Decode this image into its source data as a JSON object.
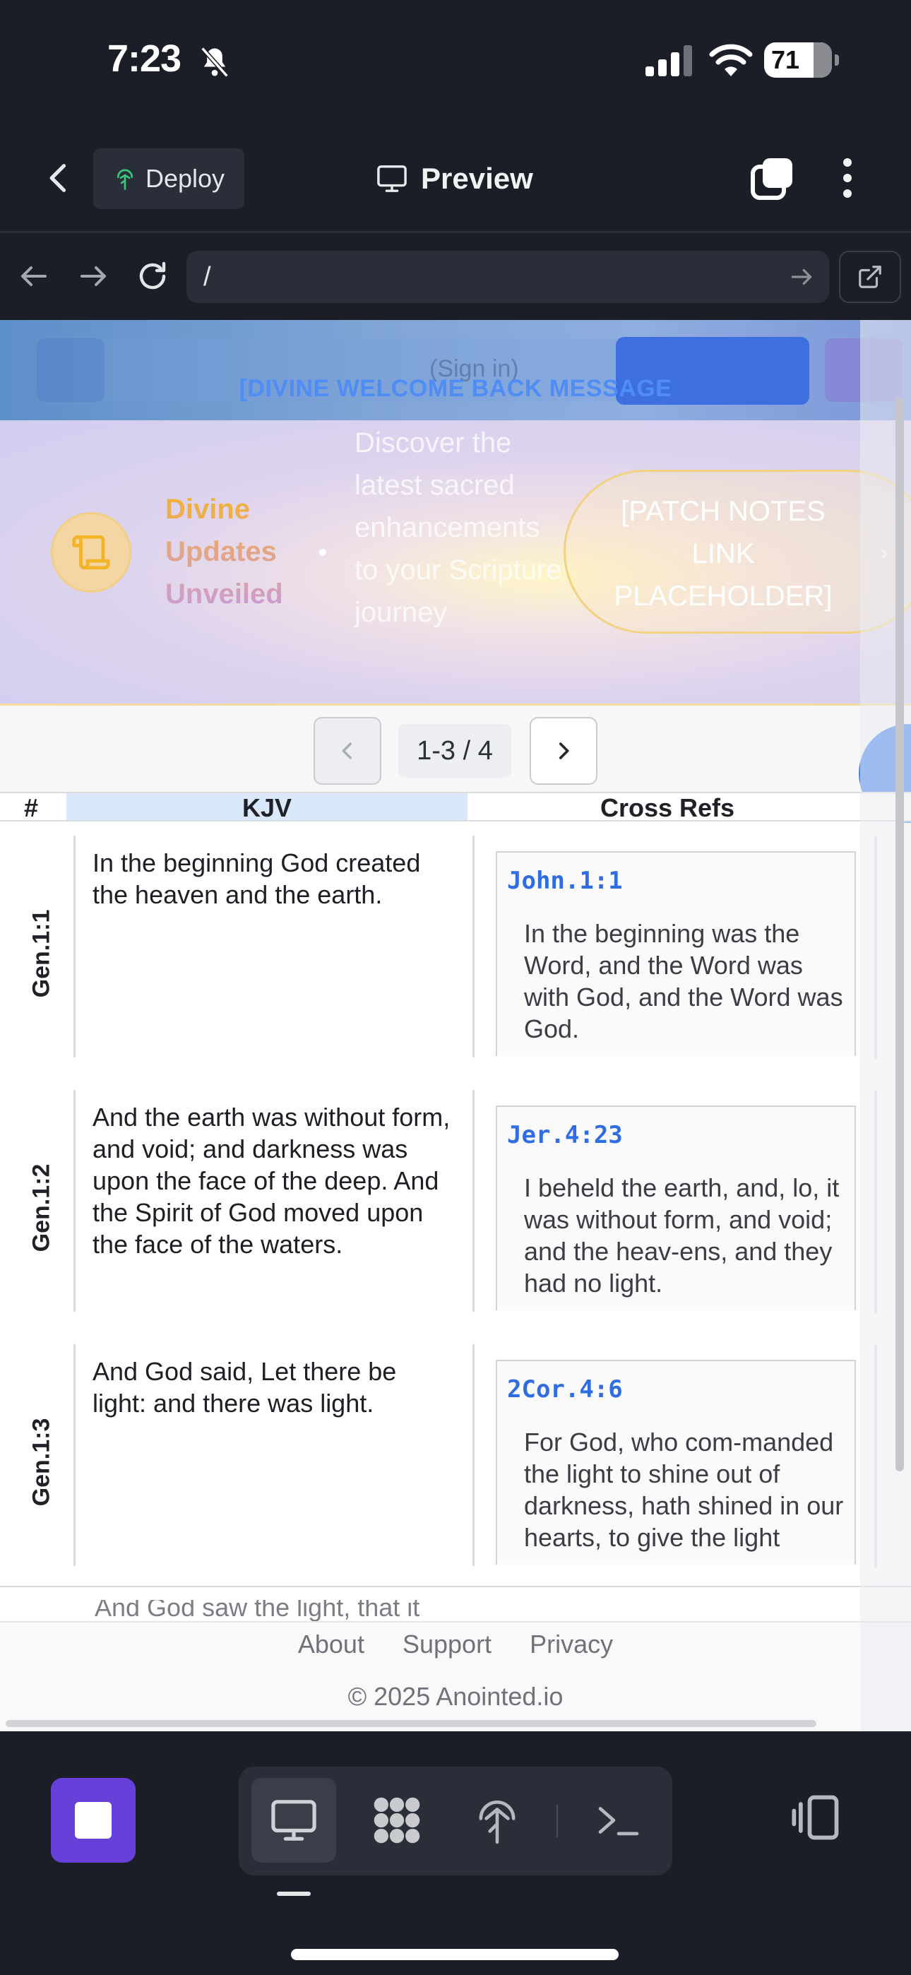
{
  "status_bar": {
    "time": "7:23",
    "battery": "71"
  },
  "app_header": {
    "deploy_label": "Deploy",
    "preview_label": "Preview"
  },
  "browser": {
    "url": "/"
  },
  "site": {
    "nav": {
      "sign_in_label": "(Sign in)",
      "welcome": "[DIVINE WELCOME BACK MESSAGE"
    },
    "banner": {
      "title": "Divine Updates Unveiled",
      "description": "Discover the latest sacred enhancements to your Scripture journey",
      "patch_link": "[PATCH NOTES LINK PLACEHOLDER]"
    },
    "pager": {
      "range": "1-3 / 4"
    },
    "table": {
      "headers": {
        "num": "#",
        "kjv": "KJV",
        "cross_refs": "Cross Refs"
      },
      "rows": [
        {
          "ref": "Gen.1:1",
          "kjv": "In the beginning God created the heaven and the earth.",
          "xref_code": "John.1:1",
          "xref_text": "In the beginning was the Word, and the Word was with God, and the Word was God."
        },
        {
          "ref": "Gen.1:2",
          "kjv": "And the earth was without form, and void; and darkness was upon the face of the deep. And the Spirit of God moved upon the face of the waters.",
          "xref_code": "Jer.4:23",
          "xref_text": "I beheld the earth, and, lo, it was without form, and void; and the heav-ens, and they had no light."
        },
        {
          "ref": "Gen.1:3",
          "kjv": "And God said, Let there be light: and there was light.",
          "xref_code": "2Cor.4:6",
          "xref_text": "For God, who com-manded the light to shine out of darkness, hath shined in our hearts, to give the light"
        }
      ],
      "partial_row_text": "And God saw the light, that it"
    },
    "footer": {
      "links": [
        "About",
        "Support",
        "Privacy"
      ],
      "copyright": "© 2025 Anointed.io"
    }
  },
  "colors": {
    "app_bg": "#1b1e27",
    "accent_purple": "#6740d9",
    "link_blue": "#2f6de0",
    "kjv_header_bg": "#d9e8fb",
    "fab_blue": "#3f82f0"
  },
  "icons": {
    "back": "chevron-left-icon",
    "deploy": "tree-icon",
    "preview": "monitor-icon",
    "tabs": "tabs-icon",
    "more": "more-vertical-icon",
    "scroll": "scroll-icon"
  }
}
